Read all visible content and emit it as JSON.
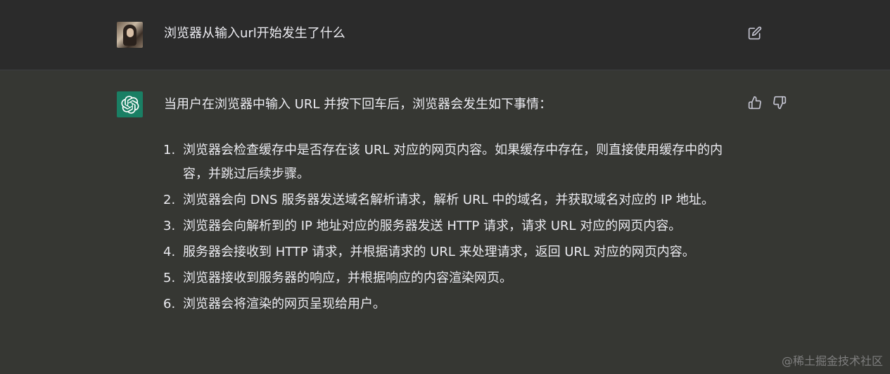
{
  "user_message": {
    "text": "浏览器从输入url开始发生了什么",
    "avatar_icon": "user-photo-avatar",
    "edit_icon": "edit-icon"
  },
  "assistant_message": {
    "avatar_icon": "openai-logo-icon",
    "avatar_color": "#1a7f64",
    "intro": "当用户在浏览器中输入 URL 并按下回车后，浏览器会发生如下事情：",
    "steps": [
      {
        "num": "1.",
        "text": "浏览器会检查缓存中是否存在该 URL 对应的网页内容。如果缓存中存在，则直接使用缓存中的内容，并跳过后续步骤。"
      },
      {
        "num": "2.",
        "text": "浏览器会向 DNS 服务器发送域名解析请求，解析 URL 中的域名，并获取域名对应的 IP 地址。"
      },
      {
        "num": "3.",
        "text": "浏览器会向解析到的 IP 地址对应的服务器发送 HTTP 请求，请求 URL 对应的网页内容。"
      },
      {
        "num": "4.",
        "text": "服务器会接收到 HTTP 请求，并根据请求的 URL 来处理请求，返回 URL 对应的网页内容。"
      },
      {
        "num": "5.",
        "text": "浏览器接收到服务器的响应，并根据响应的内容渲染网页。"
      },
      {
        "num": "6.",
        "text": "浏览器会将渲染的网页呈现给用户。"
      }
    ],
    "feedback_icons": [
      "thumbs-up-icon",
      "thumbs-down-icon"
    ]
  },
  "watermark": "@稀土掘金技术社区",
  "colors": {
    "user_row_bg": "#2b2b2b",
    "assistant_row_bg": "#363733",
    "text": "#ececf1",
    "icon": "#c5c5d2"
  }
}
